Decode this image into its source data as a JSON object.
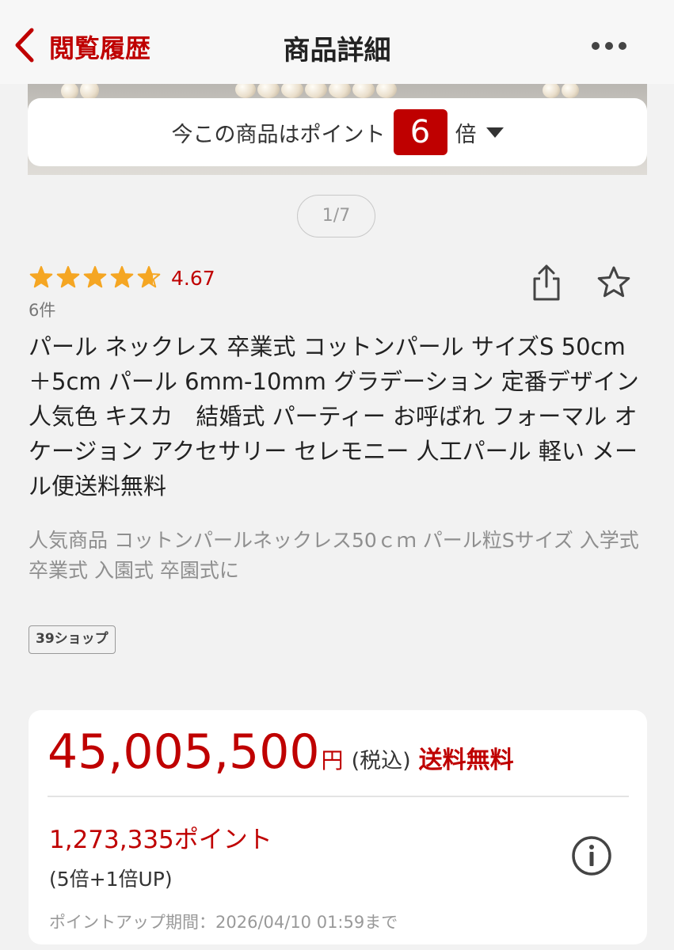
{
  "header": {
    "back_label": "閲覧履歴",
    "title": "商品詳細",
    "more_icon": "ellipsis-icon"
  },
  "point_bar": {
    "prefix": "今この商品はポイント",
    "multiplier": "6",
    "suffix": "倍"
  },
  "gallery": {
    "pager": "1/7"
  },
  "rating": {
    "value": "4.67",
    "stars": 4.67,
    "count": "6件",
    "star_color": "#f5a623"
  },
  "product": {
    "title": "パール ネックレス 卒業式 コットンパール サイズS 50cm ＋5cm パール 6mm-10mm グラデーション 定番デザイン 人気色 キスカ　結婚式 パーティー お呼ばれ フォーマル オケージョン アクセサリー セレモニー 人工パール 軽い メール便送料無料",
    "catch_copy": "人気商品 コットンパールネックレス50ｃｍ パール粒Sサイズ 入学式 卒業式 入園式 卒園式に",
    "shop_badge": "39ショップ"
  },
  "price": {
    "amount": "45,005,500",
    "yen": "円",
    "tax": "(税込)",
    "shipping": "送料無料",
    "points": "1,273,335ポイント",
    "points_detail": "(5倍+1倍UP)",
    "period": "ポイントアップ期間：2026/04/10 01:59まで"
  },
  "colors": {
    "accent": "#bf0000",
    "background": "#f2f2f2"
  }
}
